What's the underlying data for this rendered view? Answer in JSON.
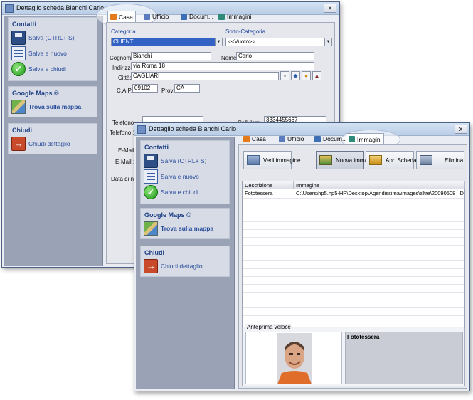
{
  "back_window": {
    "title": "Dettaglio scheda Bianchi Carlo",
    "close": "x",
    "tabs": [
      {
        "label": "Casa",
        "icon": "house-icon",
        "color": "#e47a19"
      },
      {
        "label": "Ufficio",
        "icon": "office-icon",
        "color": "#5b7bbf"
      },
      {
        "label": "Docum...",
        "icon": "document-icon",
        "color": "#3c6fb5"
      },
      {
        "label": "Immagini",
        "icon": "image-icon",
        "color": "#2f8a7a"
      }
    ],
    "sidebar": {
      "contatti_title": "Contatti",
      "salva": "Salva (CTRL+ S)",
      "salva_nuovo": "Salva e nuovo",
      "salva_chiudi": "Salva e chiudi",
      "maps_title": "Google Maps ©",
      "trova": "Trova sulla mappa",
      "chiudi_title": "Chiudi",
      "chiudi_dettaglio": "Chiudi dettaglio"
    },
    "form": {
      "categoria_label": "Categoria",
      "categoria_value": "CLIENTI",
      "sotto_categoria_label": "Sotto-Categoria",
      "sotto_categoria_value": "<<Vuoto>>",
      "cognome_label": "Cognome:",
      "cognome_value": "Bianchi",
      "nome_label": "Nome:",
      "nome_value": "Carlo",
      "indirizzo_label": "Indirizzo:",
      "indirizzo_value": "via Roma 18",
      "citta_label": "Città:",
      "citta_value": "CAGLIARI",
      "cap_label": "C.A.P.",
      "cap_value": "09102",
      "prov_label": "Prov:",
      "prov_value": "CA",
      "telefono_label": "Telefono__",
      "telefono1_label": "Telefono 1_",
      "cellulare_label": "Cellulare___",
      "cellulare_value": "3334455667",
      "email_label": "E-Mail_",
      "email1_label": "E-Mail 1_",
      "data_label": "Data di nas"
    }
  },
  "front_window": {
    "title": "Dettaglio scheda Bianchi Carlo",
    "close": "x",
    "tabs": [
      {
        "label": "Casa",
        "icon": "house-icon",
        "color": "#e47a19"
      },
      {
        "label": "Ufficio",
        "icon": "office-icon",
        "color": "#5b7bbf"
      },
      {
        "label": "Docum...",
        "icon": "document-icon",
        "color": "#3c6fb5"
      },
      {
        "label": "Immagini",
        "icon": "image-icon",
        "color": "#2f8a7a"
      }
    ],
    "sidebar": {
      "contatti_title": "Contatti",
      "salva": "Salva (CTRL+ S)",
      "salva_nuovo": "Salva e nuovo",
      "salva_chiudi": "Salva e chiudi",
      "maps_title": "Google Maps ©",
      "trova": "Trova sulla mappa",
      "chiudi_title": "Chiudi",
      "chiudi_dettaglio": "Chiudi dettaglio"
    },
    "toolbar": {
      "vedi": "Vedi immagine",
      "nuova": "Nuova immagine",
      "apri": "Apri Scheda",
      "elimina": "Elimina"
    },
    "grid": {
      "col_descrizione": "Descrizione",
      "col_immagine": "Immagine",
      "rows": [
        {
          "descrizione": "Fototessera",
          "immagine": "C:\\Users\\hp5.hp5-HP\\Desktop\\Agendissima\\images\\altre\\20090508_ID ..."
        }
      ]
    },
    "preview": {
      "title": "Anteprima veloce",
      "caption": "Fototessera"
    }
  },
  "colors": {
    "sidebar_bg": "#9aa2b5",
    "group_bg": "#d6dbe6",
    "link_blue": "#2a4d9a",
    "title_blue": "#1d3f84",
    "selection": "#3362c4"
  }
}
